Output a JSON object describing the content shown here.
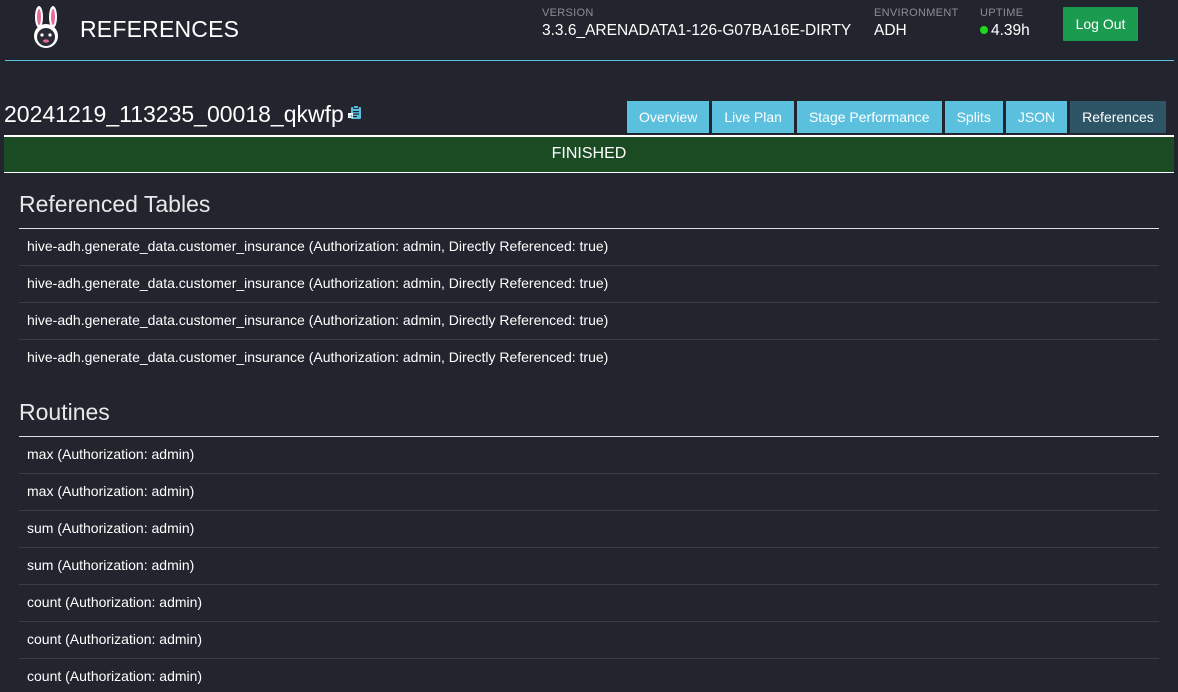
{
  "header": {
    "app_title": "REFERENCES",
    "version_label": "VERSION",
    "version_value": "3.3.6_ARENADATA1-126-G07BA16E-DIRTY",
    "environment_label": "ENVIRONMENT",
    "environment_value": "ADH",
    "uptime_label": "UPTIME",
    "uptime_value": "4.39h",
    "logout_label": "Log Out",
    "colors": {
      "logout": "#1b9b4f",
      "uptime_dot": "#1ed81e",
      "rule": "#5bc0de"
    }
  },
  "query": {
    "id": "20241219_113235_00018_qkwfp",
    "copy_icon": "clipboard-icon",
    "status": "FINISHED",
    "status_color": "#1a4b22"
  },
  "tabs": [
    {
      "label": "Overview",
      "active": false
    },
    {
      "label": "Live Plan",
      "active": false
    },
    {
      "label": "Stage Performance",
      "active": false
    },
    {
      "label": "Splits",
      "active": false
    },
    {
      "label": "JSON",
      "active": false
    },
    {
      "label": "References",
      "active": true
    }
  ],
  "referenced_tables": {
    "title": "Referenced Tables",
    "items": [
      "hive-adh.generate_data.customer_insurance (Authorization: admin, Directly Referenced: true)",
      "hive-adh.generate_data.customer_insurance (Authorization: admin, Directly Referenced: true)",
      "hive-adh.generate_data.customer_insurance (Authorization: admin, Directly Referenced: true)",
      "hive-adh.generate_data.customer_insurance (Authorization: admin, Directly Referenced: true)"
    ]
  },
  "routines": {
    "title": "Routines",
    "items": [
      "max (Authorization: admin)",
      "max (Authorization: admin)",
      "sum (Authorization: admin)",
      "sum (Authorization: admin)",
      "count (Authorization: admin)",
      "count (Authorization: admin)",
      "count (Authorization: admin)"
    ]
  }
}
